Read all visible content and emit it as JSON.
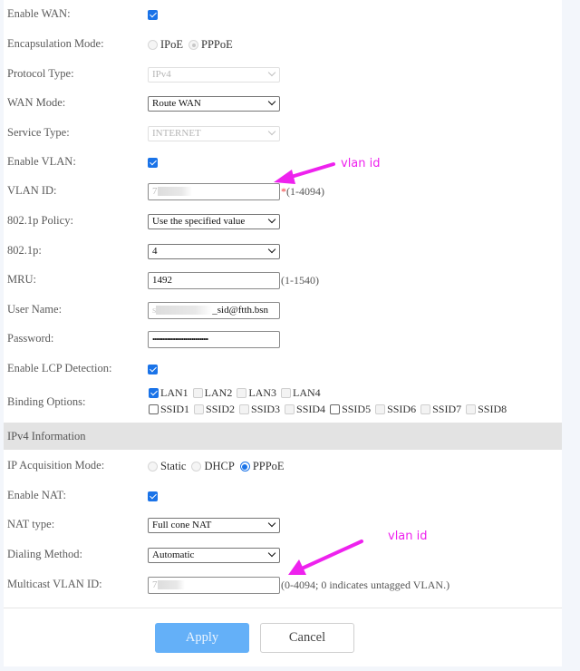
{
  "form": {
    "enable_wan": {
      "label": "Enable WAN:",
      "checked": true
    },
    "encapsulation_mode": {
      "label": "Encapsulation Mode:",
      "options": [
        "IPoE",
        "PPPoE"
      ],
      "selected": "PPPoE",
      "disabled": true
    },
    "protocol_type": {
      "label": "Protocol Type:",
      "value": "IPv4",
      "disabled": true
    },
    "wan_mode": {
      "label": "WAN Mode:",
      "value": "Route WAN"
    },
    "service_type": {
      "label": "Service Type:",
      "value": "INTERNET",
      "disabled": true
    },
    "enable_vlan": {
      "label": "Enable VLAN:",
      "checked": true
    },
    "vlan_id": {
      "label": "VLAN ID:",
      "value": "7",
      "required_mark": "*",
      "hint": "(1-4094)"
    },
    "policy_8021p": {
      "label": "802.1p Policy:",
      "value": "Use the specified value"
    },
    "value_8021p": {
      "label": "802.1p:",
      "value": "4"
    },
    "mru": {
      "label": "MRU:",
      "value": "1492",
      "hint": "(1-1540)"
    },
    "user_name": {
      "label": "User Name:",
      "value_prefix": "s",
      "value_suffix": "_sid@ftth.bsn"
    },
    "password": {
      "label": "Password:",
      "value": "••••••••••••••••••••••••••••••••••"
    },
    "enable_lcp": {
      "label": "Enable LCP Detection:",
      "checked": true
    },
    "binding_options": {
      "label": "Binding Options:",
      "lan": [
        {
          "label": "LAN1",
          "checked": true,
          "disabled": false
        },
        {
          "label": "LAN2",
          "checked": false,
          "disabled": true
        },
        {
          "label": "LAN3",
          "checked": false,
          "disabled": true
        },
        {
          "label": "LAN4",
          "checked": false,
          "disabled": true
        }
      ],
      "ssid": [
        {
          "label": "SSID1",
          "checked": false,
          "disabled": false
        },
        {
          "label": "SSID2",
          "checked": false,
          "disabled": true
        },
        {
          "label": "SSID3",
          "checked": false,
          "disabled": true
        },
        {
          "label": "SSID4",
          "checked": false,
          "disabled": true
        },
        {
          "label": "SSID5",
          "checked": false,
          "disabled": false
        },
        {
          "label": "SSID6",
          "checked": false,
          "disabled": true
        },
        {
          "label": "SSID7",
          "checked": false,
          "disabled": true
        },
        {
          "label": "SSID8",
          "checked": false,
          "disabled": true
        }
      ]
    }
  },
  "ipv4": {
    "section_title": "IPv4 Information",
    "ip_acquisition_mode": {
      "label": "IP Acquisition Mode:",
      "options": [
        "Static",
        "DHCP",
        "PPPoE"
      ],
      "selected": "PPPoE"
    },
    "enable_nat": {
      "label": "Enable NAT:",
      "checked": true
    },
    "nat_type": {
      "label": "NAT type:",
      "value": "Full cone NAT"
    },
    "dialing_method": {
      "label": "Dialing Method:",
      "value": "Automatic"
    },
    "multicast_vlan_id": {
      "label": "Multicast VLAN ID:",
      "value": "7",
      "hint": "(0-4094; 0 indicates untagged VLAN.)"
    }
  },
  "buttons": {
    "apply": "Apply",
    "cancel": "Cancel"
  },
  "annotations": {
    "label_1": "vlan id",
    "label_2": "vlan id",
    "color": "#ee22ee"
  }
}
